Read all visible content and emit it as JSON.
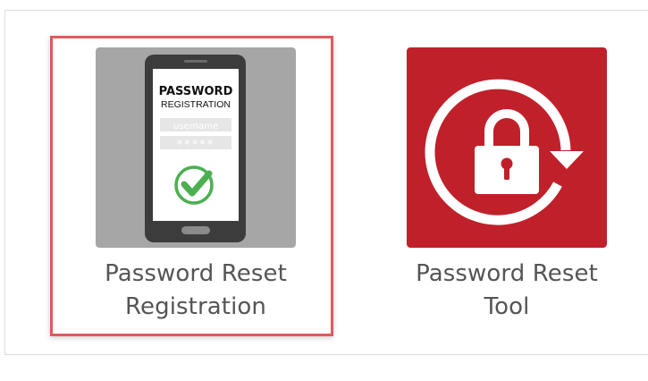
{
  "apps": [
    {
      "label_line1": "Password Reset",
      "label_line2": "Registration",
      "icon": "phone-password-registration-icon",
      "icon_text": {
        "title": "PASSWORD",
        "subtitle": "REGISTRATION",
        "username": "username",
        "password_mask": "*****"
      },
      "background_color": "#a6a6a6",
      "selected": true
    },
    {
      "label_line1": "Password Reset",
      "label_line2": "Tool",
      "icon": "lock-refresh-icon",
      "background_color": "#c0202a",
      "selected": false
    }
  ],
  "colors": {
    "selection_border": "#e05a5e",
    "label_text": "#555555",
    "check_green": "#4caf50"
  }
}
